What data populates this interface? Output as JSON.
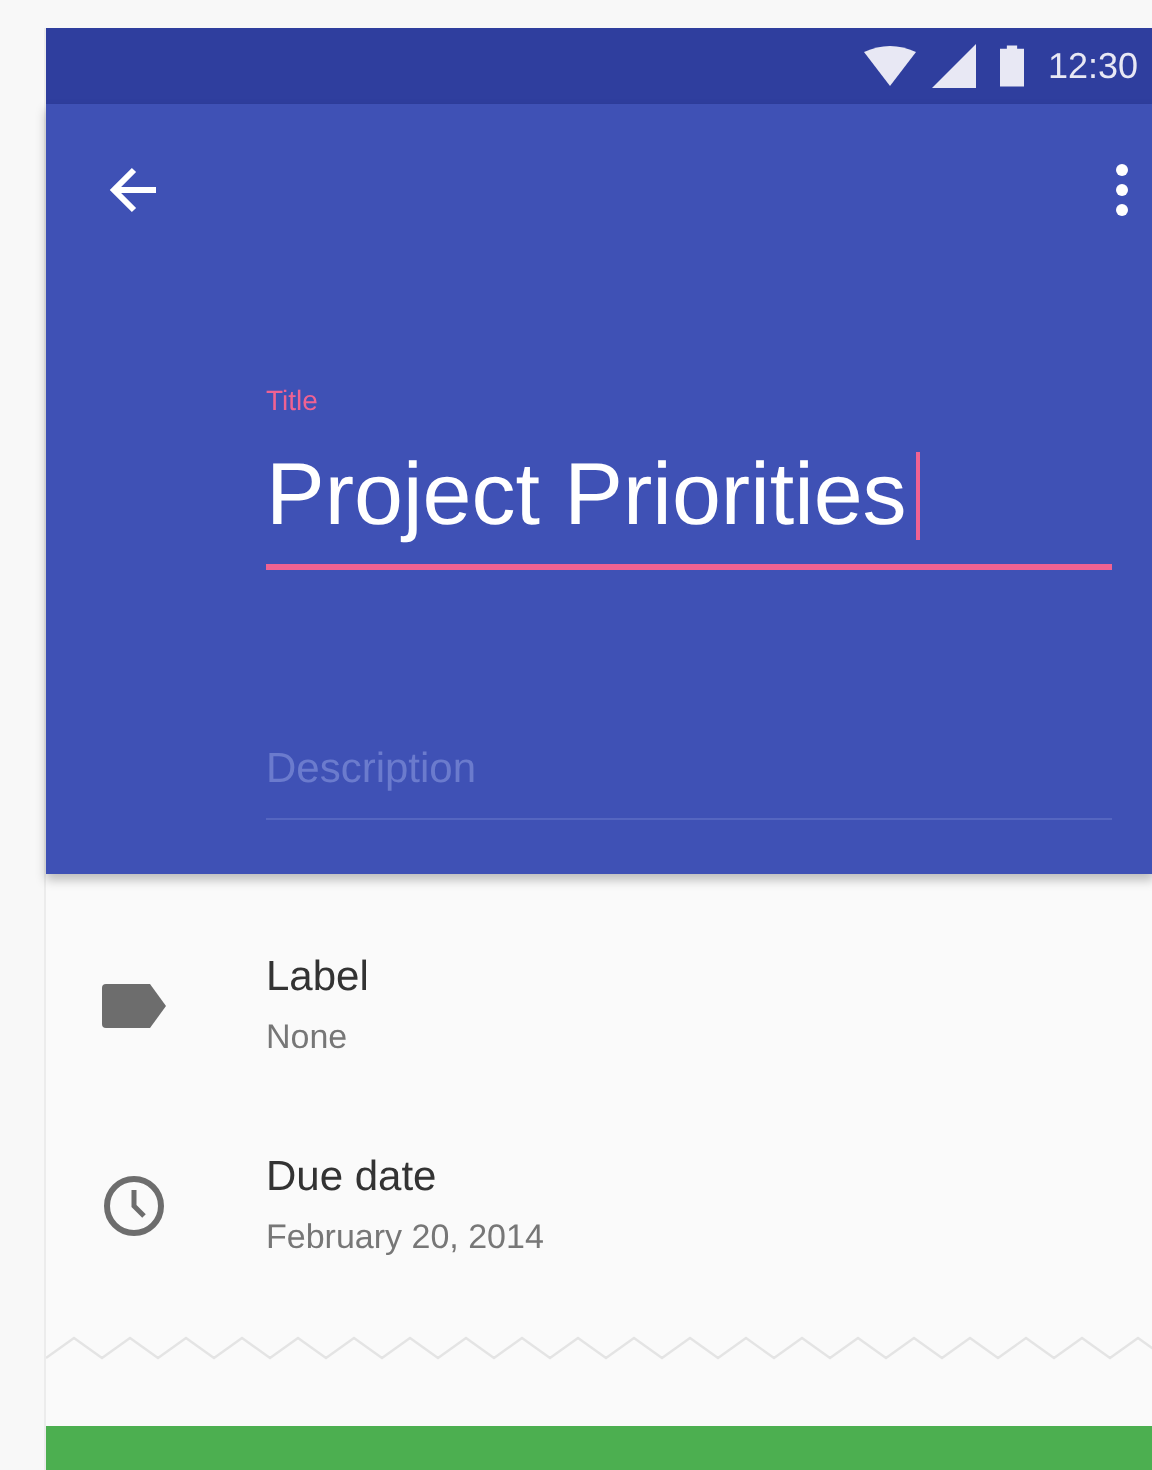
{
  "status_bar": {
    "time": "12:30"
  },
  "title_field": {
    "label": "Title",
    "value": "Project Priorities"
  },
  "description_field": {
    "placeholder": "Description"
  },
  "details": [
    {
      "kind": "label",
      "title": "Label",
      "value": "None"
    },
    {
      "kind": "due_date",
      "title": "Due date",
      "value": "February 20, 2014"
    }
  ]
}
